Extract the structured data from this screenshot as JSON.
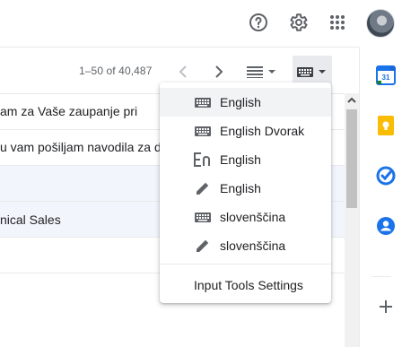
{
  "header": {
    "icons": [
      "help-icon",
      "settings-icon",
      "apps-icon"
    ],
    "avatar": "user-avatar"
  },
  "toolbar": {
    "pagination": "1–50 of 40,487",
    "icons": [
      "chevron-left-icon",
      "chevron-right-icon",
      "split-pane-icon",
      "keyboard-icon"
    ]
  },
  "messages": [
    {
      "snippet": "am za Vaše zaupanje pri"
    },
    {
      "snippet": "u vam pošiljam navodila za d"
    },
    {
      "snippet": ""
    },
    {
      "snippet": "nical Sales"
    },
    {
      "snippet": ""
    }
  ],
  "input_menu": {
    "items": [
      {
        "icon": "keyboard-icon",
        "label": "English"
      },
      {
        "icon": "keyboard-icon",
        "label": "English Dvorak"
      },
      {
        "icon": "transliteration-icon",
        "label": "English"
      },
      {
        "icon": "pencil-icon",
        "label": "English"
      },
      {
        "icon": "keyboard-icon",
        "label": "slovenščina"
      },
      {
        "icon": "pencil-icon",
        "label": "slovenščina"
      }
    ],
    "settings_label": "Input Tools Settings"
  },
  "side_panel": {
    "icons": [
      "calendar-icon",
      "keep-icon",
      "tasks-icon",
      "contacts-icon",
      "add-icon"
    ],
    "calendar_day": "31"
  },
  "colors": {
    "calendar_blue": "#1a73e8",
    "keep_yellow": "#fbbc04",
    "tasks_blue": "#1a73e8",
    "contacts_blue": "#1a73e8"
  }
}
